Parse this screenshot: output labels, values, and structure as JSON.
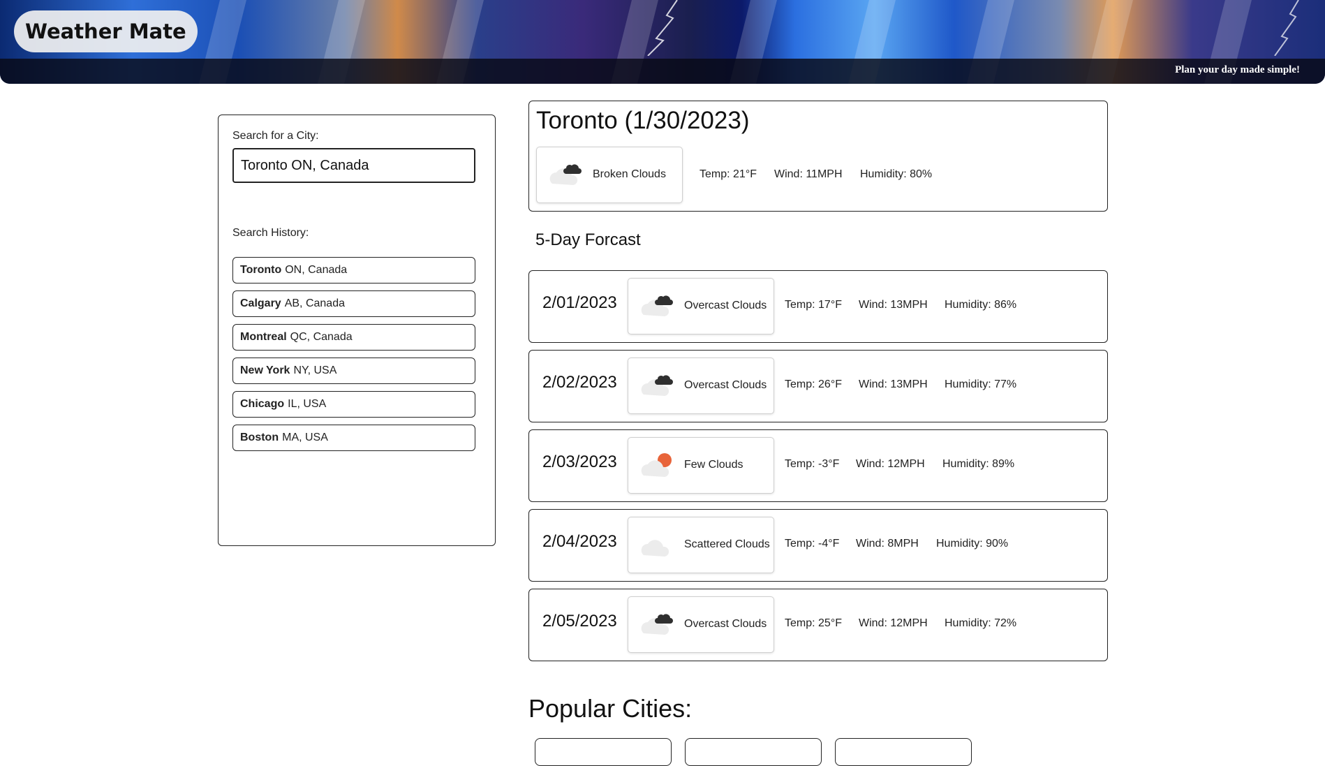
{
  "header": {
    "title": "Weather Mate",
    "tagline": "Plan your day made simple!"
  },
  "search": {
    "label": "Search for a City:",
    "value": "Toronto ON, Canada",
    "history_label": "Search History:",
    "history": [
      {
        "city": "Toronto",
        "region": "ON, Canada"
      },
      {
        "city": "Calgary",
        "region": "AB, Canada"
      },
      {
        "city": "Montreal",
        "region": "QC, Canada"
      },
      {
        "city": "New York",
        "region": "NY, USA"
      },
      {
        "city": "Chicago",
        "region": "IL, USA"
      },
      {
        "city": "Boston",
        "region": "MA, USA"
      }
    ]
  },
  "current": {
    "title": "Toronto (1/30/2023)",
    "condition": "Broken Clouds",
    "icon": "broken-clouds-icon",
    "temp": "Temp: 21°F",
    "wind": "Wind: 11MPH",
    "humidity": "Humidity: 80%"
  },
  "forecast": {
    "heading": "5-Day Forcast",
    "days": [
      {
        "date": "2/01/2023",
        "condition": "Overcast Clouds",
        "icon": "overcast-clouds-icon",
        "temp": "Temp: 17°F",
        "wind": "Wind: 13MPH",
        "humidity": "Humidity: 86%"
      },
      {
        "date": "2/02/2023",
        "condition": "Overcast Clouds",
        "icon": "overcast-clouds-icon",
        "temp": "Temp: 26°F",
        "wind": "Wind: 13MPH",
        "humidity": "Humidity: 77%"
      },
      {
        "date": "2/03/2023",
        "condition": "Few Clouds",
        "icon": "few-clouds-icon",
        "temp": "Temp: -3°F",
        "wind": "Wind: 12MPH",
        "humidity": "Humidity: 89%"
      },
      {
        "date": "2/04/2023",
        "condition": "Scattered Clouds",
        "icon": "scattered-clouds-icon",
        "temp": "Temp: -4°F",
        "wind": "Wind: 8MPH",
        "humidity": "Humidity: 90%"
      },
      {
        "date": "2/05/2023",
        "condition": "Overcast Clouds",
        "icon": "overcast-clouds-icon",
        "temp": "Temp: 25°F",
        "wind": "Wind: 12MPH",
        "humidity": "Humidity: 72%"
      }
    ]
  },
  "popular": {
    "heading": "Popular Cities:"
  },
  "colors": {
    "sun": "#e8643a",
    "cloud_light": "#ececec",
    "cloud_dark": "#2f2f2f",
    "border": "#222222"
  }
}
